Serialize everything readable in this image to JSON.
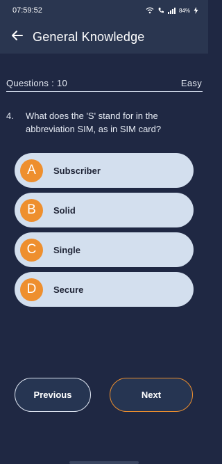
{
  "status_bar": {
    "time": "07:59:52",
    "battery": "84%"
  },
  "app_bar": {
    "title": "General Knowledge"
  },
  "quiz": {
    "questions_label": "Questions : 10",
    "difficulty": "Easy",
    "question_number": "4.",
    "question_text": "What does the 'S' stand for in the abbreviation SIM, as in SIM card?"
  },
  "options": [
    {
      "letter": "A",
      "label": "Subscriber"
    },
    {
      "letter": "B",
      "label": "Solid"
    },
    {
      "letter": "C",
      "label": "Single"
    },
    {
      "letter": "D",
      "label": "Secure"
    }
  ],
  "navigation": {
    "previous_label": "Previous",
    "next_label": "Next"
  },
  "colors": {
    "background": "#1f2843",
    "app_bar": "#2a3650",
    "accent": "#ee8f2e",
    "option_bg": "#d3dfee"
  }
}
